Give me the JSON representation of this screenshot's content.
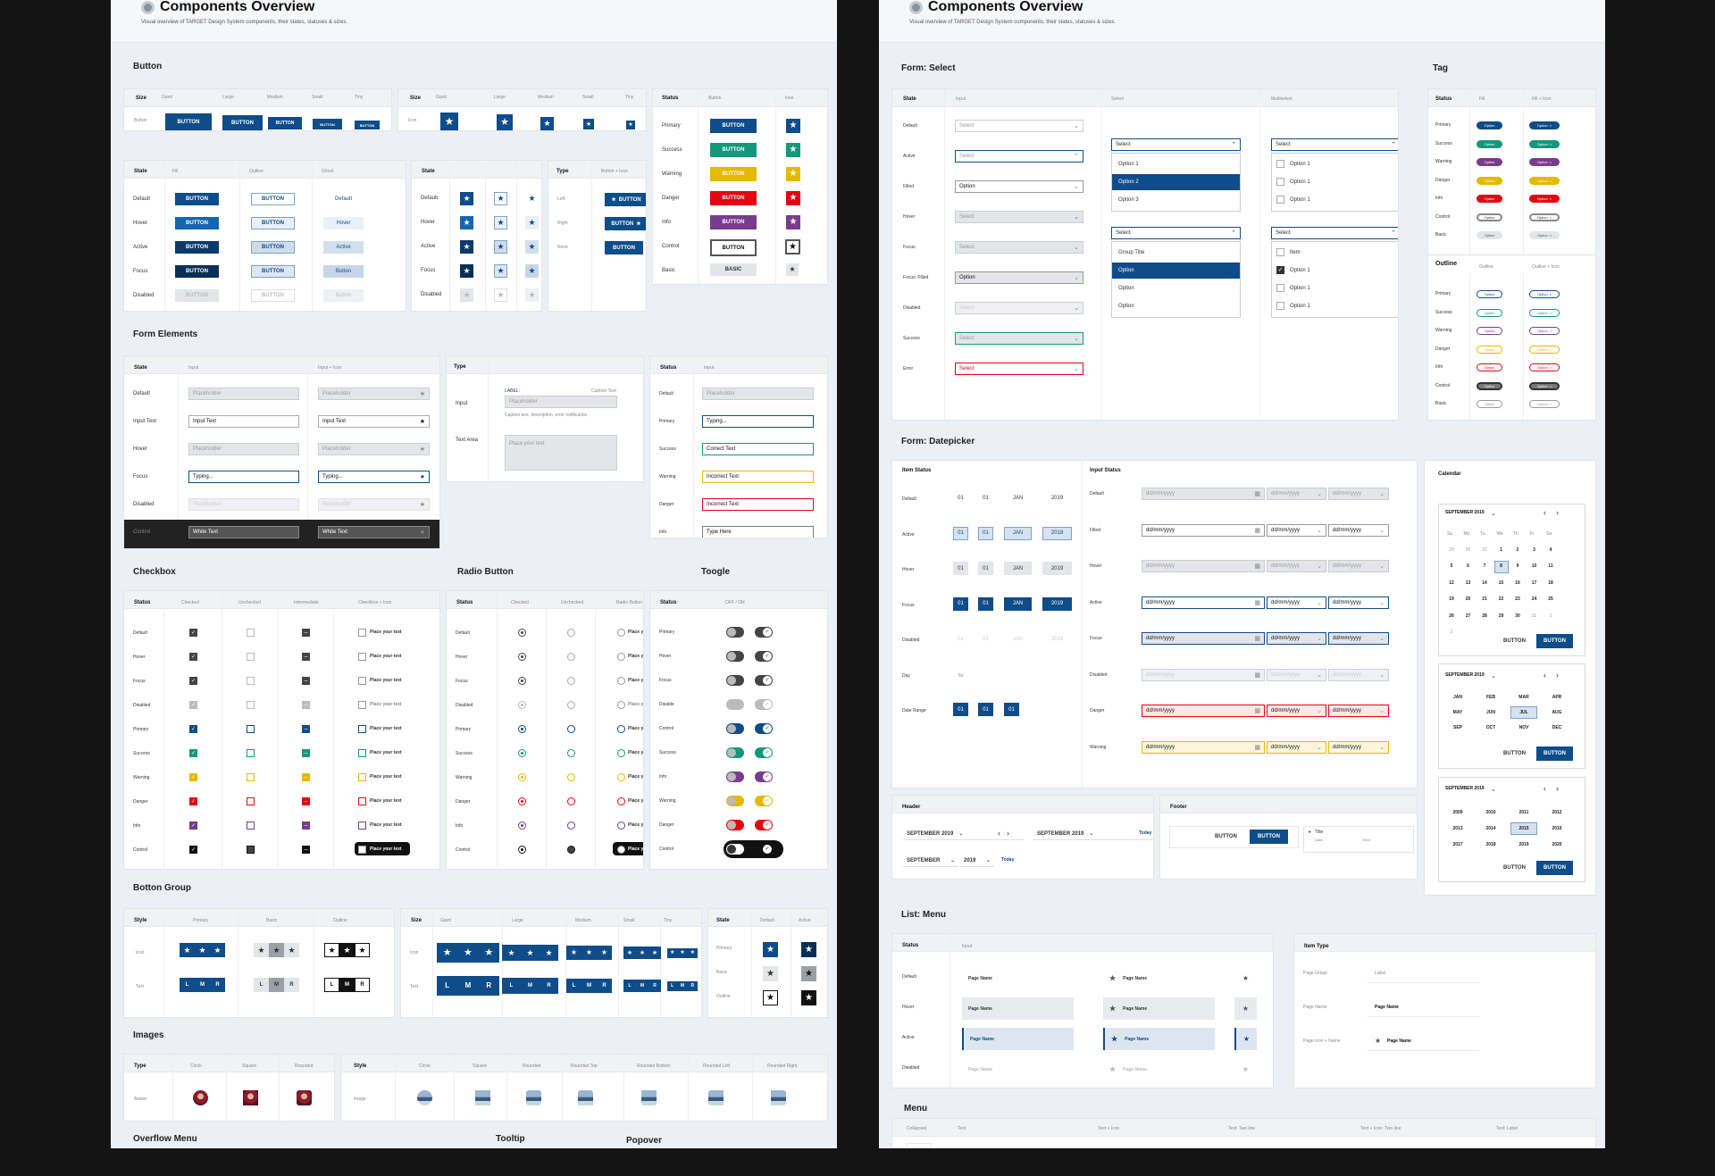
{
  "title": "Components Overview",
  "subtitle": "Visual overview of TARGET Design System components, their states, statuses & sizes.",
  "colors": {
    "primary": "#0f4c8a",
    "success": "#13987a",
    "warning": "#e6b800",
    "danger": "#e30613",
    "info": "#7a3b8f",
    "control": "#333333",
    "basic": "#e3e5e8"
  },
  "sections": {
    "button": "Button",
    "form_elements": "Form Elements",
    "checkbox": "Checkbox",
    "radio": "Radio Button",
    "toggle": "Toogle",
    "button_group": "Botton Group",
    "images": "Images",
    "overflow": "Overflow Menu",
    "tooltip": "Tooltip",
    "popover": "Popover",
    "select": "Form: Select",
    "tag": "Tag",
    "datepicker": "Form: Datepicker",
    "list_menu": "List: Menu",
    "menu": "Menu"
  },
  "common": {
    "size": "Size",
    "state": "State",
    "status": "Status",
    "type": "Type",
    "style": "Style",
    "button": "BUTTON",
    "basic": "BASIC",
    "button_label": "Button",
    "icon_label": "Icon",
    "input": "Input",
    "text": "Text",
    "placeholder": "Placeholder",
    "place_text": "Place your text",
    "option": "Option",
    "select": "Select",
    "page_name": "Page Name",
    "ddmm": "dd/mm/yyyy"
  },
  "sizes": [
    "Giant",
    "Large",
    "Medium",
    "Small",
    "Tiny"
  ],
  "states": [
    "Default",
    "Hover",
    "Active",
    "Focus",
    "Disabled"
  ],
  "statuses": [
    "Primary",
    "Success",
    "Warning",
    "Danger",
    "Info",
    "Control",
    "Basic"
  ],
  "btn_states_cols": [
    "Fill",
    "Outline",
    "Ghost"
  ],
  "ghost": [
    "Default",
    "Hover",
    "Active",
    "Button",
    "Button"
  ],
  "btn_type": {
    "col": "Button + Icon",
    "rows": [
      "Left",
      "Right",
      "None"
    ]
  },
  "form": {
    "cols": [
      "Input",
      "Input + Icon"
    ],
    "rows": [
      "Default",
      "Input Text",
      "Hover",
      "Focus",
      "Disabled",
      "Control"
    ],
    "values": [
      "Placeholder",
      "Input Text",
      "Placeholder",
      "Typing...",
      "Placeholder",
      "White Text"
    ],
    "type_rows": [
      "Input",
      "Text Area"
    ],
    "label": "LABEL:",
    "caption": "Caption Text",
    "caption2": "Caption text, description, error notification",
    "textarea": "Place your text",
    "status_rows": [
      "Default",
      "Primary",
      "Success",
      "Warning",
      "Danger",
      "Info"
    ],
    "status_vals": [
      "Placeholder",
      "Typing...",
      "Correct Text",
      "Incorrect Text",
      "Incorrect Text",
      "Type Here"
    ]
  },
  "check": {
    "cols": [
      "Checked",
      "Unchecked",
      "Intermediate",
      "Checkbox + Icon"
    ],
    "rows": [
      "Default",
      "Hover",
      "Focus",
      "Disabled",
      "Primary",
      "Success",
      "Warning",
      "Danger",
      "Info",
      "Control"
    ]
  },
  "radio": {
    "cols": [
      "Checked",
      "Unchecked",
      "Radio Button + Icon"
    ]
  },
  "toggle": {
    "col": "OFF / ON",
    "rows": [
      "Primary",
      "Hover",
      "Focus",
      "Disable",
      "Control",
      "Success",
      "Info",
      "Warning",
      "Danger",
      "Control"
    ]
  },
  "group": {
    "cols": [
      "Primary",
      "Basic",
      "Outline"
    ],
    "rows": [
      "Icon",
      "Text"
    ],
    "letters": [
      "L",
      "M",
      "R"
    ],
    "state_cols": [
      "Default",
      "Active"
    ],
    "state_rows": [
      "Primary",
      "Basic",
      "Outline"
    ]
  },
  "images": {
    "cols": [
      "Circle",
      "Square",
      "Rounded"
    ],
    "row": "Avatar",
    "cols2": [
      "Circle",
      "Square",
      "Rounded",
      "Rounded Top",
      "Rounded Bottom",
      "Rounded Left",
      "Rounded Right"
    ],
    "row2": "Image"
  },
  "select": {
    "cols": [
      "Input",
      "Select",
      "Multiselect"
    ],
    "rows": [
      "Default",
      "Active",
      "Filled",
      "Hover",
      "Focus",
      "Focus: Filled",
      "Disabled",
      "Success",
      "Error"
    ],
    "opts": [
      "Option 1",
      "Option 2",
      "Option 3"
    ],
    "group_title": "Group Title",
    "item": "Item"
  },
  "tag": {
    "fill_cols": [
      "Fill",
      "Fill + Icon"
    ],
    "outline": "Outline",
    "outline_cols": [
      "Outline",
      "Outline + Icon"
    ]
  },
  "date": {
    "item_status": "Item Status",
    "input_status": "Input Status",
    "item_rows": [
      "Default",
      "Active",
      "Hover",
      "Focus",
      "Disabled",
      "Day",
      "Date Range"
    ],
    "cells": [
      "01",
      "01",
      "JAN",
      "2019"
    ],
    "day": "5o",
    "input_rows": [
      "Default",
      "Filled",
      "Hover",
      "Active",
      "Focus",
      "Disabled",
      "Danger",
      "Warning"
    ],
    "header": "Header",
    "footer": "Footer",
    "month_year": "SEPTEMBER 2019",
    "month": "SEPTEMBER",
    "year": "2019",
    "today": "Today",
    "title_item": "Title",
    "date_lbl": "Date:",
    "time_lbl": "Time:",
    "calendar": "Calendar",
    "weekdays": [
      "Su",
      "Mo",
      "Tu",
      "We",
      "Th",
      "Fr",
      "Sa"
    ],
    "days": [
      "29",
      "30",
      "31",
      "1",
      "2",
      "3",
      "4",
      "5",
      "6",
      "7",
      "8",
      "9",
      "10",
      "11",
      "12",
      "13",
      "14",
      "15",
      "16",
      "17",
      "18",
      "19",
      "20",
      "21",
      "22",
      "23",
      "24",
      "25",
      "26",
      "27",
      "28",
      "29",
      "30",
      "31",
      "1",
      "2"
    ],
    "months": [
      "JAN",
      "FEB",
      "MAR",
      "APR",
      "MAY",
      "JUN",
      "JUL",
      "AUG",
      "SEP",
      "OCT",
      "NOV",
      "DEC"
    ],
    "years": [
      "2009",
      "2010",
      "2011",
      "2012",
      "2013",
      "2014",
      "2015",
      "2016",
      "2017",
      "2018",
      "2019",
      "2020"
    ]
  },
  "list": {
    "rows": [
      "Default",
      "Hover",
      "Active",
      "Disabled"
    ],
    "item_type": "Item Type",
    "types": [
      "Page Group",
      "Page Name",
      "Page Icon + Name"
    ],
    "label": "Label"
  },
  "menu_cols": [
    "Collapsed",
    "Text",
    "Text + Icon",
    "Text: Two line",
    "Text + Icon: Two line",
    "Text: Label"
  ]
}
